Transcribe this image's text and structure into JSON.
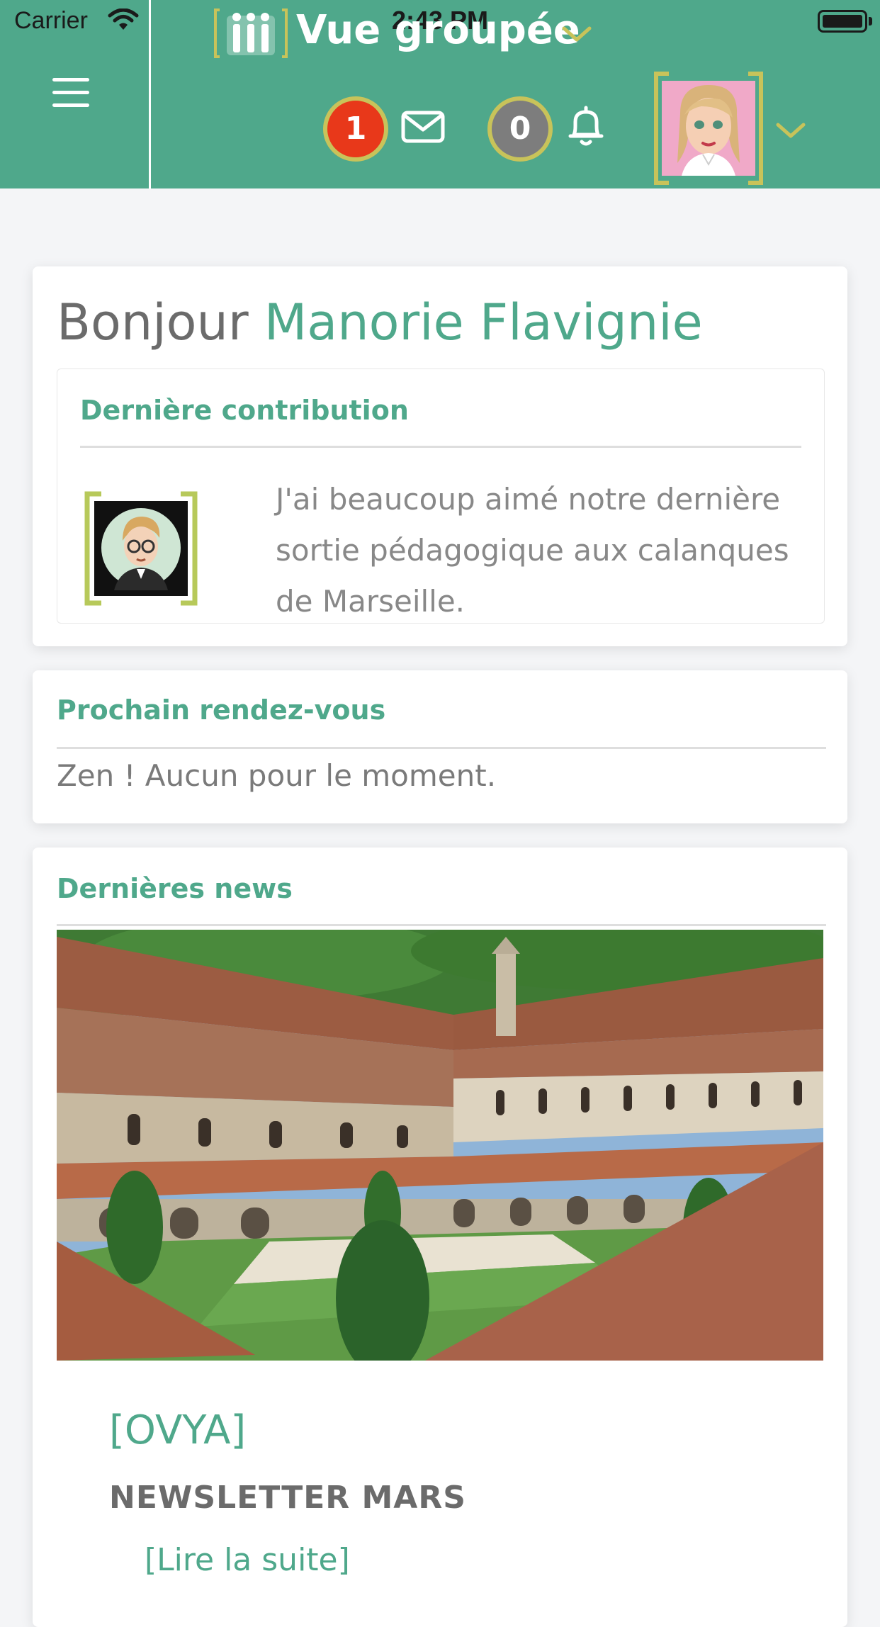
{
  "status_bar": {
    "carrier": "Carrier",
    "time": "2:43 PM"
  },
  "header": {
    "menu_icon": "hamburger-menu-icon",
    "view_title": "Vue groupée",
    "messages_count": "1",
    "notifications_count": "0",
    "accent_color": "#4fa88b",
    "badge_border_color": "#c8c35a",
    "messages_badge_color": "#e8381a",
    "notifications_badge_color": "#7d7d7d"
  },
  "welcome": {
    "greeting": "Bonjour",
    "user_name": "Manorie Flavignie"
  },
  "last_contribution": {
    "title": "Dernière contribution",
    "text": "J'ai beaucoup aimé notre dernière sortie pédagogique aux calanques de Marseille."
  },
  "next_meeting": {
    "title": "Prochain rendez-vous",
    "text": "Zen ! Aucun pour le moment."
  },
  "news": {
    "title": "Dernières news",
    "items": [
      {
        "source": "[OVYA]",
        "headline": "NEWSLETTER MARS",
        "link_label": "[Lire la suite]"
      }
    ]
  }
}
